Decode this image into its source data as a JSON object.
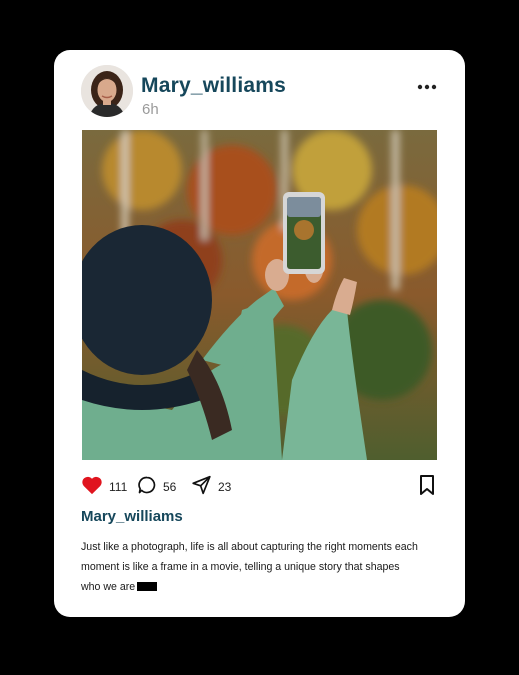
{
  "post": {
    "username": "Mary_williams",
    "time": "6h",
    "likes": "111",
    "comments": "56",
    "shares": "23",
    "caption_username": "Mary_williams",
    "caption_line1": "Just like a photograph, life is all about capturing the right moments each",
    "caption_line2": "moment is like a frame in a movie, telling a unique story that shapes",
    "caption_line3": "who we are"
  },
  "colors": {
    "accent": "#16475b",
    "like": "#e0141e",
    "background": "#000000",
    "card": "#ffffff"
  },
  "icons": [
    "more-options-icon",
    "heart-icon",
    "comment-icon",
    "share-icon",
    "bookmark-icon"
  ]
}
